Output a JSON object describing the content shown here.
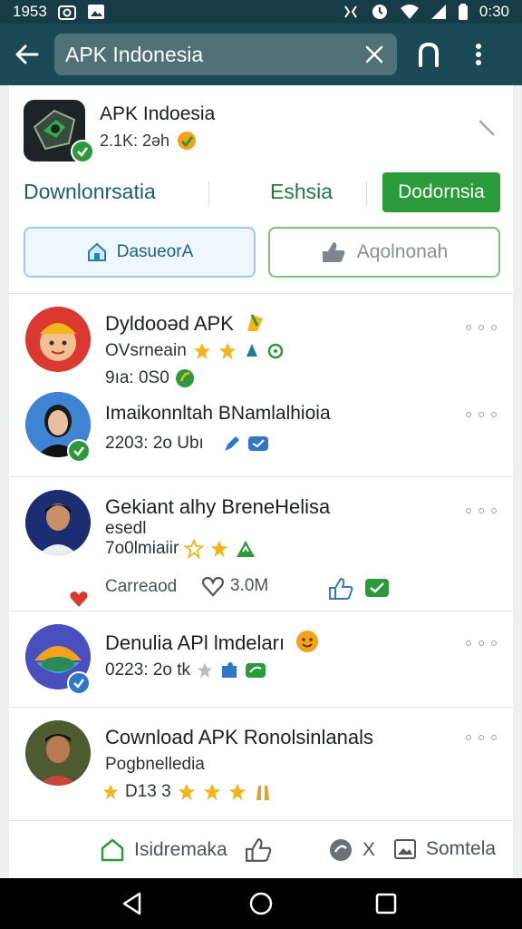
{
  "status_bar": {
    "time_left": "1953",
    "time_right": "0:30"
  },
  "search": {
    "value": "APK Indonesia"
  },
  "app": {
    "title": "APK Indoesia",
    "meta": "2.1K: 2əh",
    "tabs": [
      "Downlonrsatia",
      "Eshsia",
      "Dodornsia"
    ],
    "btn_primary": "DasueorA",
    "btn_secondary": "Aqolnonah"
  },
  "feed": [
    {
      "title": "Dyldooəd APK",
      "sub1": "OVsrneain",
      "sub2": "9ıa: 0S0"
    },
    {
      "title": "Imaikonnltah BNamlalhioia",
      "sub1": "2203: 2o Ubı"
    },
    {
      "title": "Gekiant alhy BreneHelisa",
      "sub1": "esedl",
      "sub2": "7o0lmiaiir",
      "sub3": "Carreaod",
      "likes": "3.0M"
    },
    {
      "title": "Denulia APl lmdeları",
      "sub1": "0223: 2o tk"
    },
    {
      "title": "Cownload APK Ronolsinlanals",
      "sub1": "Pogbnelledia",
      "sub2": "D13 3"
    }
  ],
  "bottom_actions": {
    "home": "Isidremaka",
    "x": "X",
    "more": "Somtela"
  },
  "colors": {
    "appbar": "#1a4a55",
    "accent_green": "#2a9a3a",
    "link_teal": "#1b5f6a"
  },
  "icons": [
    "back-arrow-icon",
    "close-icon",
    "headset-icon",
    "more-vert-icon",
    "wifi-icon",
    "battery-icon",
    "star-icon",
    "thumbs-up-icon",
    "heart-icon",
    "home-icon",
    "nav-back-icon",
    "nav-home-icon",
    "nav-recents-icon"
  ]
}
